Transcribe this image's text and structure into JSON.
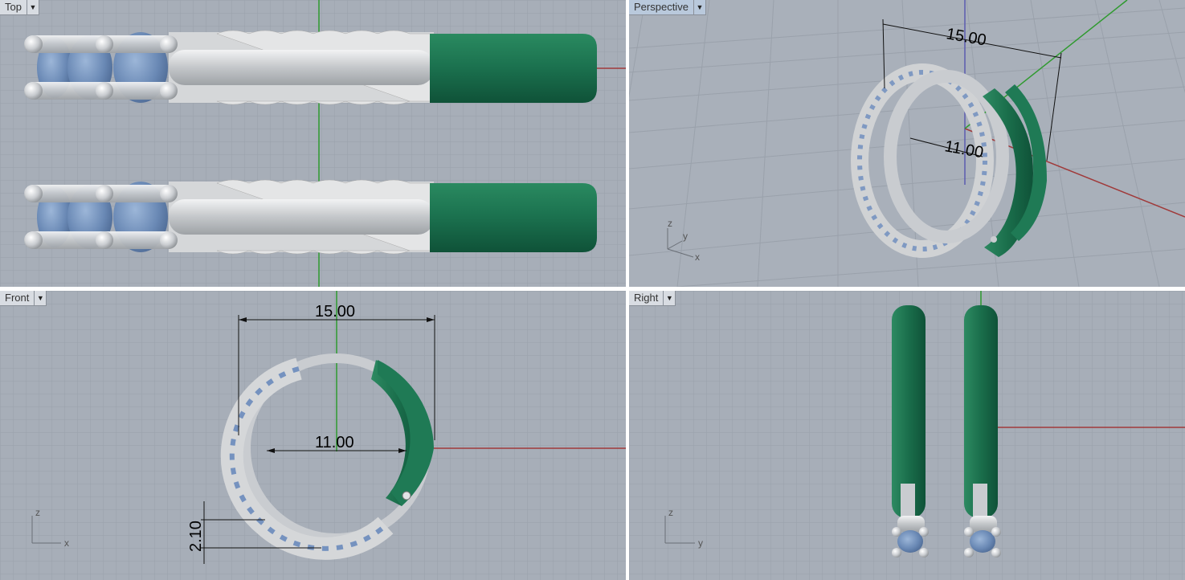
{
  "colors": {
    "viewport_bg": "#a7aeb8",
    "grid_minor": "#9aa1ab",
    "grid_major": "#8c939d",
    "x_axis": "#a03a3a",
    "y_axis": "#2f9a2f",
    "z_axis": "#5b5bb0",
    "metal": "#d0d2d4",
    "gem": "#6f8fbd",
    "enamel": "#1f7a55"
  },
  "viewports": {
    "top": {
      "label": "Top",
      "menu_icon": "dropdown-arrow-icon"
    },
    "perspective": {
      "label": "Perspective",
      "menu_icon": "dropdown-arrow-icon",
      "dims": {
        "outer": "15.00",
        "inner": "11.00"
      },
      "axes": {
        "z": "z",
        "y": "y",
        "x": "x"
      }
    },
    "front": {
      "label": "Front",
      "menu_icon": "dropdown-arrow-icon",
      "dims": {
        "outer": "15.00",
        "inner": "11.00",
        "height": "2.10"
      },
      "axes": {
        "z": "z",
        "x": "x"
      }
    },
    "right": {
      "label": "Right",
      "menu_icon": "dropdown-arrow-icon",
      "axes": {
        "z": "z",
        "y": "y"
      }
    }
  }
}
